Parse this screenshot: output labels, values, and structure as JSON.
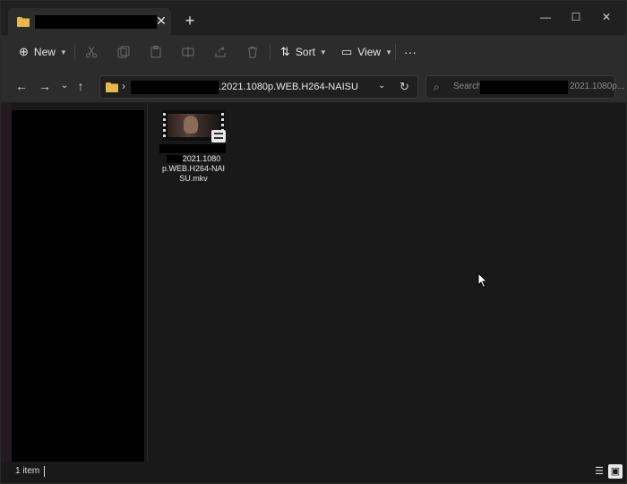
{
  "window": {
    "tab_title": "",
    "new_tab_symbol": "+",
    "close_symbol": "✕",
    "minimize_symbol": "—",
    "maximize_symbol": "☐",
    "window_close_symbol": "✕"
  },
  "toolbar": {
    "new_label": "New",
    "sort_label": "Sort",
    "view_label": "View",
    "more_label": "···",
    "icons": [
      "cut-icon",
      "copy-icon",
      "paste-icon",
      "rename-icon",
      "share-icon",
      "delete-icon"
    ]
  },
  "address_bar": {
    "path_suffix": ".2021.1080p.WEB.H264-NAISU",
    "separator": "›"
  },
  "search": {
    "placeholder_prefix": "Search",
    "placeholder_suffix": "2021.1080p..."
  },
  "content": {
    "files": [
      {
        "name_line1": "2021.1080",
        "name_line2": "p.WEB.H264-NAI",
        "name_line3": "SU.mkv",
        "type": "video-file"
      }
    ]
  },
  "statusbar": {
    "item_count": "1 item"
  },
  "colors": {
    "background": "#191919",
    "toolbar": "#2c2c2c",
    "folder": "#e8b84a"
  }
}
